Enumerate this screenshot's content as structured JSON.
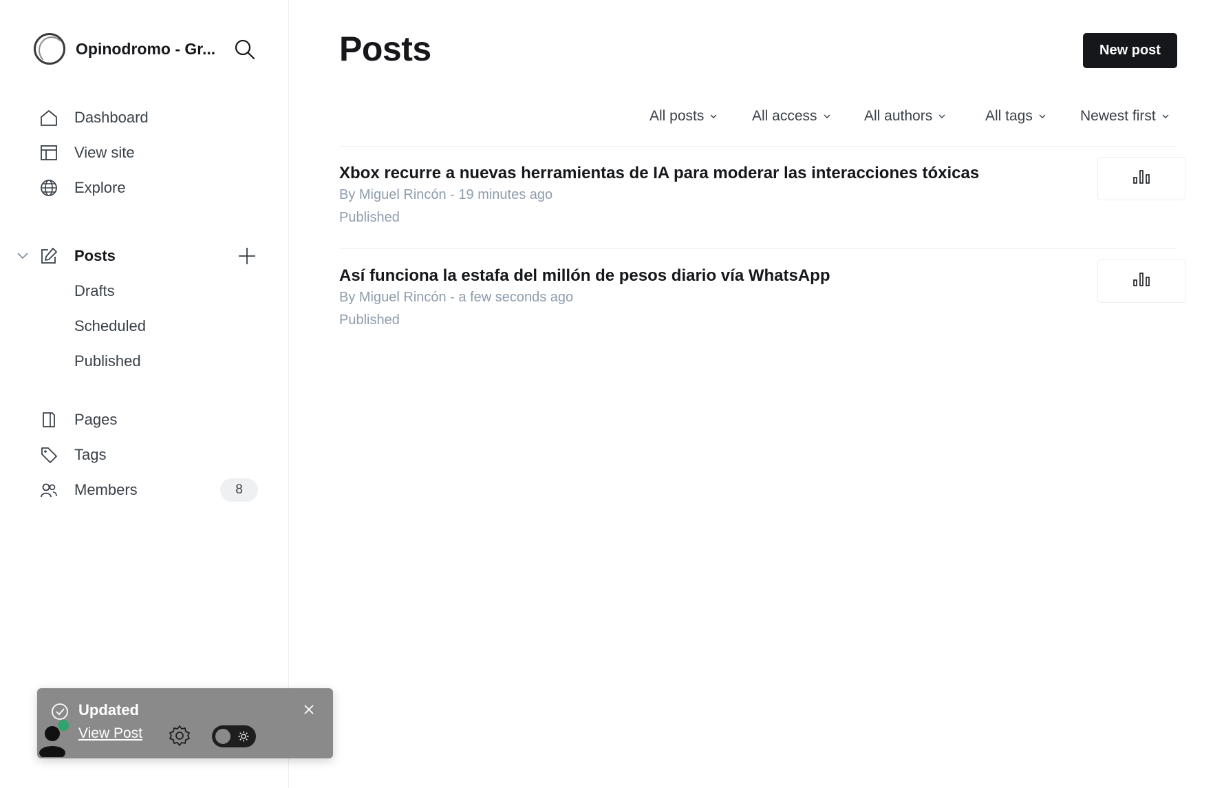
{
  "sidebar": {
    "brand": "Opinodromo - Gr...",
    "nav": [
      {
        "label": "Dashboard",
        "icon": "home-icon"
      },
      {
        "label": "View site",
        "icon": "layout-icon"
      },
      {
        "label": "Explore",
        "icon": "globe-icon"
      }
    ],
    "posts": {
      "label": "Posts",
      "subitems": [
        "Drafts",
        "Scheduled",
        "Published"
      ]
    },
    "nav2": [
      {
        "label": "Pages",
        "icon": "page-icon"
      },
      {
        "label": "Tags",
        "icon": "tag-icon"
      },
      {
        "label": "Members",
        "icon": "members-icon",
        "badge": "8"
      }
    ]
  },
  "header": {
    "title": "Posts",
    "new_post_label": "New post"
  },
  "filters": [
    "All posts",
    "All access",
    "All authors",
    "All tags",
    "Newest first"
  ],
  "posts": [
    {
      "title": "Xbox recurre a nuevas herramientas de IA para moderar las interacciones tóxicas",
      "meta": "By Miguel Rincón - 19 minutes ago",
      "status": "Published"
    },
    {
      "title": "Así funciona la estafa del millón de pesos diario vía WhatsApp",
      "meta": "By Miguel Rincón - a few seconds ago",
      "status": "Published"
    }
  ],
  "toast": {
    "title": "Updated",
    "link": "View Post"
  }
}
